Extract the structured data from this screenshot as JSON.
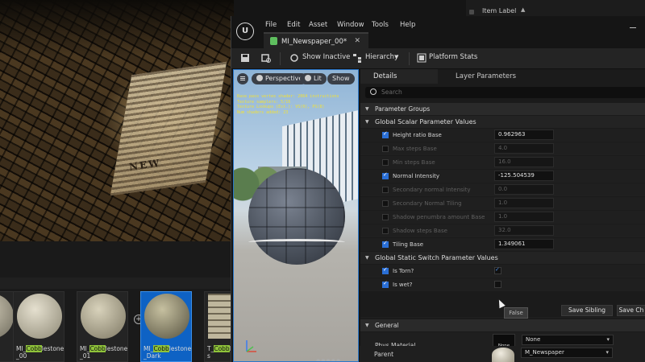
{
  "outliner": {
    "column_label": "Item Label",
    "sort_arrow": "▲"
  },
  "scene": {
    "paper_text": "NEW"
  },
  "content_browser": {
    "add_icon": "+",
    "caret": "▾",
    "tiles": [
      {
        "prefix": "MI_",
        "highlight": "Cobb",
        "suffix": "lestone_00",
        "selected": false
      },
      {
        "prefix": "MI_",
        "highlight": "Cobb",
        "suffix": "lestone_01",
        "selected": false
      },
      {
        "prefix": "MI_",
        "highlight": "Cobb",
        "suffix": "lestone_Dark",
        "selected": true
      },
      {
        "prefix": "T_",
        "highlight": "Cobb",
        "suffix": "Base_Bas",
        "selected": false
      }
    ]
  },
  "menu": [
    "File",
    "Edit",
    "Asset",
    "Window",
    "Tools",
    "Help"
  ],
  "logo_text": "U",
  "tab": {
    "title": "MI_Newspaper_00*",
    "close": "✕"
  },
  "toolbar": {
    "show_inactive": "Show Inactive",
    "hierarchy": "Hierarchy",
    "platform_stats": "Platform Stats"
  },
  "viewport": {
    "perspective": "Perspective",
    "lit": "Lit",
    "show": "Show",
    "stats": [
      "Base pass vertex shader: 2064 instructions",
      "Texture samplers: 5/16",
      "Texture Lookups (Est.): VS(0), PS(8)",
      "Num shaders added: 23"
    ]
  },
  "details": {
    "tab_details": "Details",
    "tab_layer": "Layer Parameters",
    "search_placeholder": "Search",
    "parameter_groups": "Parameter Groups",
    "scalar_header": "Global Scalar Parameter Values",
    "scalar_rows": [
      {
        "label": "Height ratio Base",
        "value": "0.962963",
        "enabled": true
      },
      {
        "label": "Max steps Base",
        "value": "4.0",
        "enabled": false
      },
      {
        "label": "Min steps Base",
        "value": "16.0",
        "enabled": false
      },
      {
        "label": "Normal Intensity",
        "value": "-125.504539",
        "enabled": true
      },
      {
        "label": "Secondary normal Intensity",
        "value": "0.0",
        "enabled": false
      },
      {
        "label": "Secondary Normal Tiling",
        "value": "1.0",
        "enabled": false
      },
      {
        "label": "Shadow penumbra amount Base",
        "value": "1.0",
        "enabled": false
      },
      {
        "label": "Shadow steps Base",
        "value": "32.0",
        "enabled": false
      },
      {
        "label": "Tiling Base",
        "value": "1.349061",
        "enabled": true
      }
    ],
    "switch_header": "Global Static Switch Parameter Values",
    "switch_rows": [
      {
        "label": "Is Torn?",
        "enabled": true,
        "value": true
      },
      {
        "label": "Is wet?",
        "enabled": true,
        "value": false
      }
    ],
    "tooltip": "False",
    "save_sibling": "Save Sibling",
    "save_child": "Save Ch",
    "general_header": "General",
    "phys_material_label": "Phys Material",
    "phys_material_thumb": "None",
    "phys_material_value": "None",
    "parent_label": "Parent",
    "parent_value": "M_Newspaper"
  }
}
